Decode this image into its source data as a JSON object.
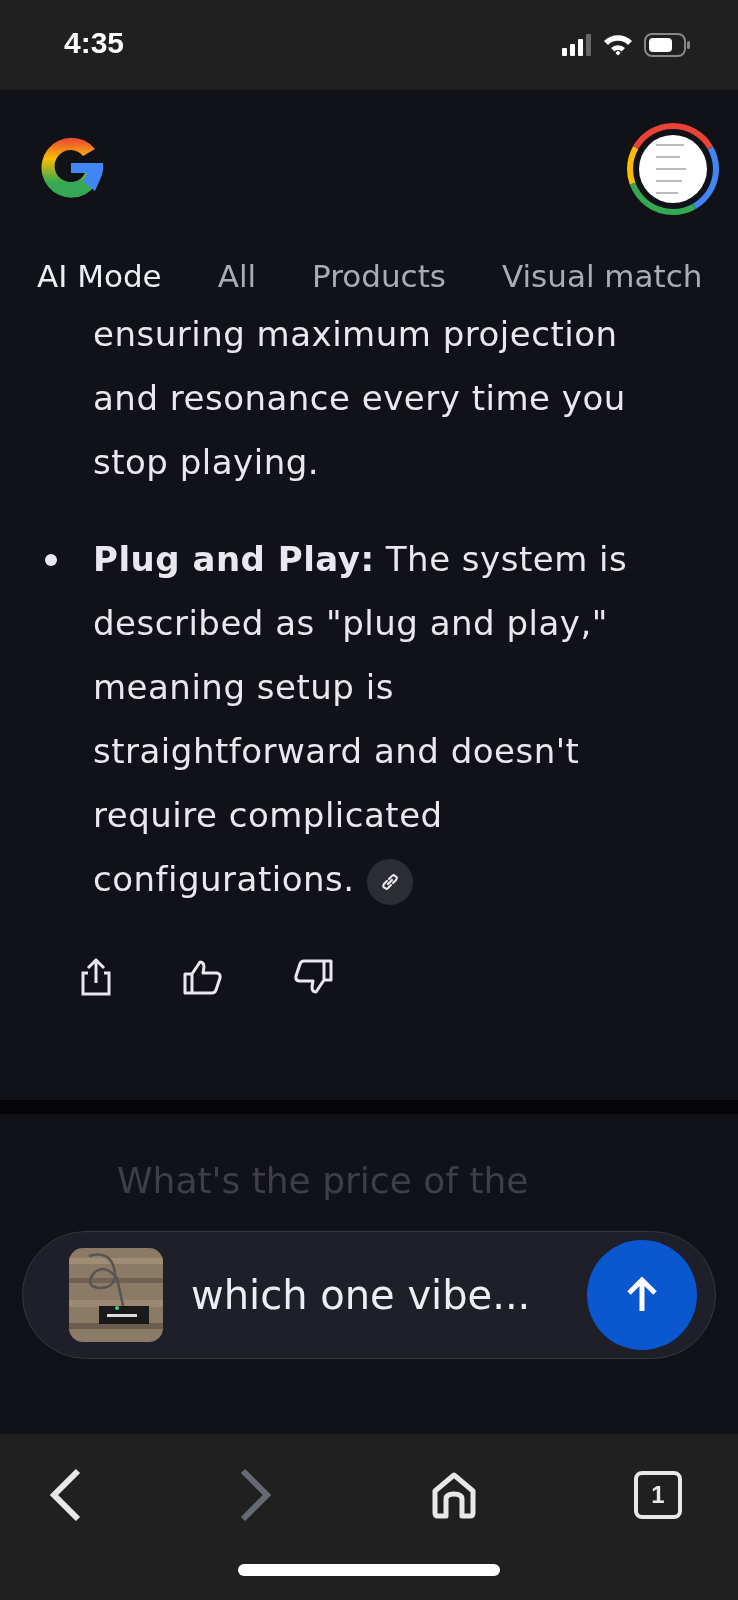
{
  "status_bar": {
    "time": "4:35"
  },
  "tabs": [
    {
      "label": "AI Mode",
      "selected": true
    },
    {
      "label": "All",
      "selected": false
    },
    {
      "label": "Products",
      "selected": false
    },
    {
      "label": "Visual match",
      "selected": false
    }
  ],
  "answer": {
    "paragraph": "ensuring maximum projection and resonance every time you stop playing.",
    "bullets": [
      {
        "text": "**Plug and Play:** The system is described as \"plug and play,\" meaning setup is straightforward and doesn't require complicated configurations.",
        "has_source_link": true
      }
    ]
  },
  "next_question": "What's the price of the",
  "prompt_field": {
    "value": "which one vibe..."
  },
  "browser_toolbar": {
    "back_disabled": false,
    "forward_disabled": true,
    "tab_count": "1"
  }
}
